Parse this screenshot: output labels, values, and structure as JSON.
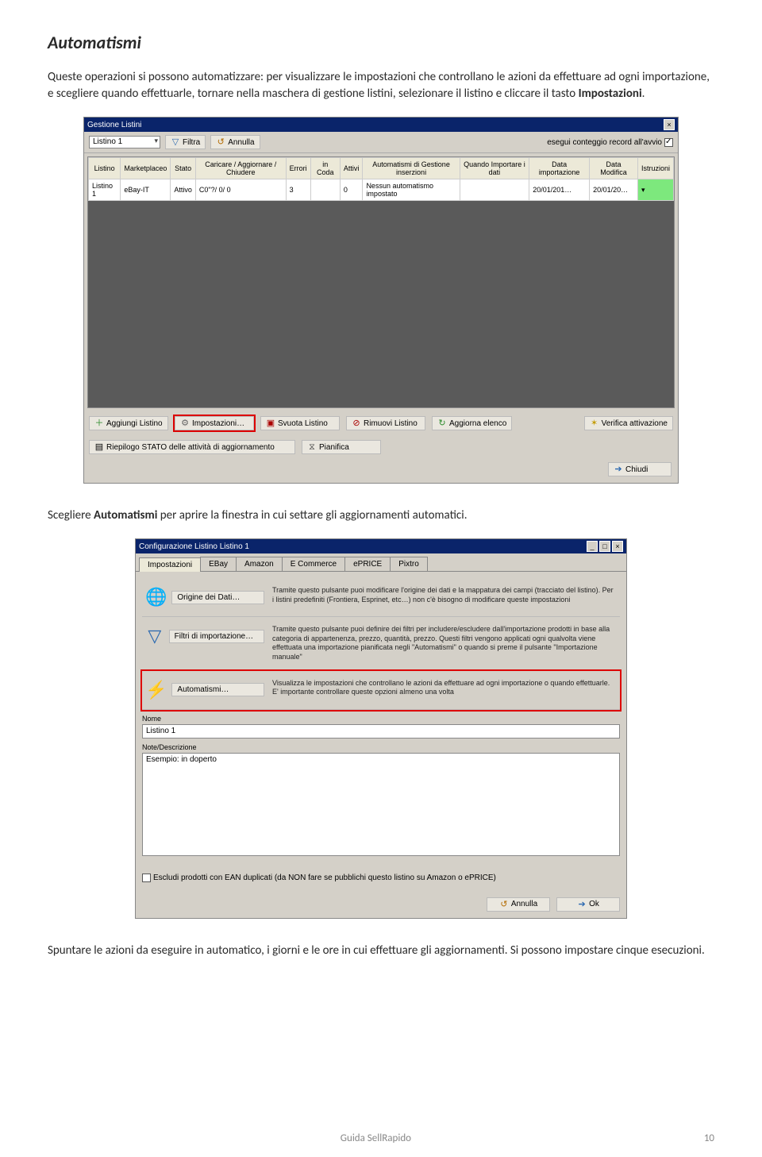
{
  "section_title": "Automatismi",
  "para1_a": "Queste operazioni si possono automatizzare: per visualizzare le impostazioni che controllano le azioni da effettuare ad ogni importazione, e scegliere quando effettuarle, tornare nella maschera di gestione listini, selezionare il listino e cliccare il tasto ",
  "para1_b": "Impostazioni",
  "para1_c": ".",
  "para2_a": "Scegliere ",
  "para2_b": "Automatismi",
  "para2_c": " per aprire la finestra in cui settare gli aggiornamenti automatici.",
  "para3": "Spuntare le azioni da eseguire in automatico, i giorni e le ore in cui effettuare gli aggiornamenti. Si possono impostare cinque esecuzioni.",
  "footer_text": "Guida SellRapido",
  "footer_page": "10",
  "win1": {
    "title": "Gestione Listini",
    "combo": "Listino 1",
    "filtra": "Filtra",
    "annulla": "Annulla",
    "conteggio": "esegui conteggio record all'avvio",
    "headers": [
      "Listino",
      "Marketplaceo",
      "Stato",
      "Caricare / Aggiornare / Chiudere",
      "Errori",
      "in Coda",
      "Attivi",
      "Automatismi di Gestione inserzioni",
      "Quando Importare i dati",
      "Data importazione",
      "Data Modifica",
      "Istruzioni"
    ],
    "row": [
      "Listino 1",
      "eBay-IT",
      "Attivo",
      "C0\"?/   0/   0",
      "3",
      "",
      "0",
      "Nessun automatismo impostato",
      "",
      "20/01/201…",
      "20/01/20…",
      ""
    ],
    "btns": {
      "aggiungi": "Aggiungi Listino",
      "impostazioni": "Impostazioni…",
      "svuota": "Svuota Listino",
      "rimuovi": "Rimuovi Listino",
      "aggiorna": "Aggiorna elenco",
      "verifica": "Verifica attivazione",
      "riepilogo": "Riepilogo STATO delle attività di aggiornamento",
      "pianifica": "Pianifica",
      "chiudi": "Chiudi"
    }
  },
  "win2": {
    "title": "Configurazione Listino Listino 1",
    "tabs": [
      "Impostazioni",
      "EBay",
      "Amazon",
      "E Commerce",
      "ePRICE",
      "Pixtro"
    ],
    "row1_btn": "Origine dei Dati…",
    "row1_desc": "Tramite questo pulsante puoi modificare l'origine dei dati e la mappatura dei campi (tracciato del listino). Per i listini predefiniti (Frontiera, Esprinet, etc…) non c'è bisogno di modificare queste impostazioni",
    "row2_btn": "Filtri di importazione…",
    "row2_desc": "Tramite questo pulsante puoi definire dei filtri per includere/escludere dall'importazione prodotti in base alla categoria di appartenenza, prezzo, quantità, prezzo. Questi filtri vengono applicati ogni qualvolta viene effettuata una importazione pianificata negli \"Automatismi\" o quando si preme il pulsante \"Importazione manuale\"",
    "row3_btn": "Automatismi…",
    "row3_desc": "Visualizza le impostazioni che controllano le azioni da effettuare ad ogni importazione o quando effettuarle. E' importante controllare queste opzioni almeno una volta",
    "nome_label": "Nome",
    "nome_value": "Listino 1",
    "note_label": "Note/Descrizione",
    "note_value": "Esempio: in doperto",
    "ean_check": "Escludi prodotti con EAN duplicati (da NON fare se pubblichi questo listino su Amazon o ePRICE)",
    "btn_annulla": "Annulla",
    "btn_ok": "Ok"
  }
}
